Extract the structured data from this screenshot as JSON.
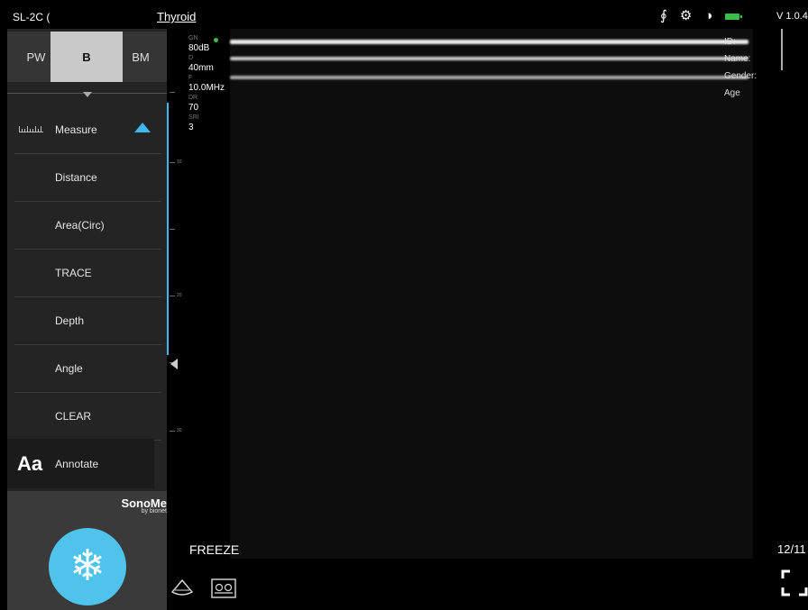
{
  "topbar": {
    "probe": "SL-2C (",
    "preset": "Thyroid",
    "version": "V 1.0.4",
    "icons": [
      "person-icon",
      "gear-icon",
      "contrast-icon",
      "battery-icon"
    ]
  },
  "mode_tabs": [
    {
      "label": "PW"
    },
    {
      "label": "B",
      "selected": true
    },
    {
      "label": "BM"
    }
  ],
  "menu": {
    "header": "Measure",
    "items": [
      "Distance",
      "Area(Circ)",
      "TRACE",
      "Depth",
      "Angle",
      "CLEAR"
    ],
    "annotate_icon": "Aa",
    "annotate": "Annotate"
  },
  "brand": {
    "name": "SonoMe",
    "sub": "by bionet"
  },
  "params": [
    {
      "key": "GN",
      "value": "80dB"
    },
    {
      "key": "D",
      "value": "40mm"
    },
    {
      "key": "F",
      "value": "10.0MHz"
    },
    {
      "key": "DR",
      "value": "70"
    },
    {
      "key": "SRI",
      "value": "3"
    }
  ],
  "scale_labels": [
    "10",
    "20",
    "30"
  ],
  "patient": {
    "id": "ID:",
    "name": "Name:",
    "gender": "Gender:",
    "age": "Age"
  },
  "status": {
    "freeze": "FREEZE",
    "page": "12/11"
  },
  "colors": {
    "accent": "#3eb8ee",
    "freeze_button": "#4fc3ec",
    "battery": "#3bbf4a"
  }
}
